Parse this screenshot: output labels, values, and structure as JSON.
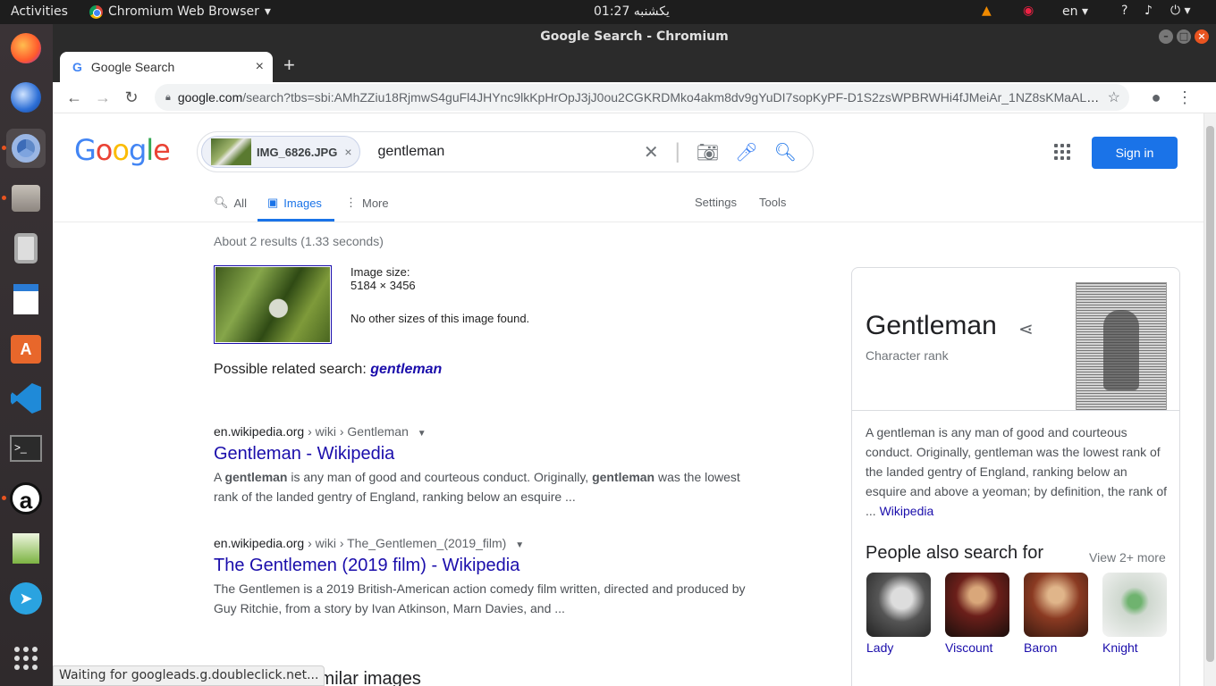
{
  "topbar": {
    "activities": "Activities",
    "app_name": "Chromium Web Browser",
    "clock": "01:27 يكشنبه",
    "lang": "en"
  },
  "window": {
    "title": "Google Search - Chromium",
    "tab_title": "Google Search",
    "url_domain": "google.com",
    "url_rest": "/search?tbs=sbi:AMhZZiu18RjmwS4guFl4JHYnc9lkKpHrOpJ3jJ0ou2CGKRDMko4akm8dv9gYuDI7sopKyPF-D1S2zsWPBRWHi4fJMeiAr_1NZ8sKMaALtf3..."
  },
  "search": {
    "chip_label": "IMG_6826.JPG",
    "query": "gentleman",
    "signin_label": "Sign in",
    "tabs": [
      {
        "label": "All"
      },
      {
        "label": "Images"
      },
      {
        "label": "More"
      }
    ],
    "settings_label": "Settings",
    "tools_label": "Tools"
  },
  "results": {
    "stats": "About 2 results (1.33 seconds)",
    "image_size_label": "Image size:",
    "image_size_value": "5184 × 3456",
    "no_other_sizes": "No other sizes of this image found.",
    "related_prefix": "Possible related search:",
    "related_link": "gentleman",
    "items": [
      {
        "domain": "en.wikipedia.org",
        "path": "› wiki › Gentleman",
        "title": "Gentleman - Wikipedia",
        "snippet_1": "A ",
        "snippet_b1": "gentleman",
        "snippet_2": " is any man of good and courteous conduct. Originally, ",
        "snippet_b2": "gentleman",
        "snippet_3": " was the lowest rank of the landed gentry of England, ranking below an esquire ..."
      },
      {
        "domain": "en.wikipedia.org",
        "path": "› wiki › The_Gentlemen_(2019_film)",
        "title": "The Gentlemen (2019 film) - Wikipedia",
        "snippet": "The Gentlemen is a 2019 British-American action comedy film written, directed and produced by Guy Ritchie, from a story by Ivan Atkinson, Marn Davies, and ..."
      }
    ],
    "similar_heading": "Visually similar images"
  },
  "knowledge_panel": {
    "title": "Gentleman",
    "subtitle": "Character rank",
    "description": "A gentleman is any man of good and courteous conduct. Originally, gentleman was the lowest rank of the landed gentry of England, ranking below an esquire and above a yeoman; by definition, the rank of ... ",
    "source_link": "Wikipedia",
    "people_heading": "People also search for",
    "view_more": "View 2+ more",
    "people": [
      {
        "name": "Lady"
      },
      {
        "name": "Viscount"
      },
      {
        "name": "Baron"
      },
      {
        "name": "Knight"
      }
    ]
  },
  "status": "Waiting for googleads.g.doubleclick.net..."
}
